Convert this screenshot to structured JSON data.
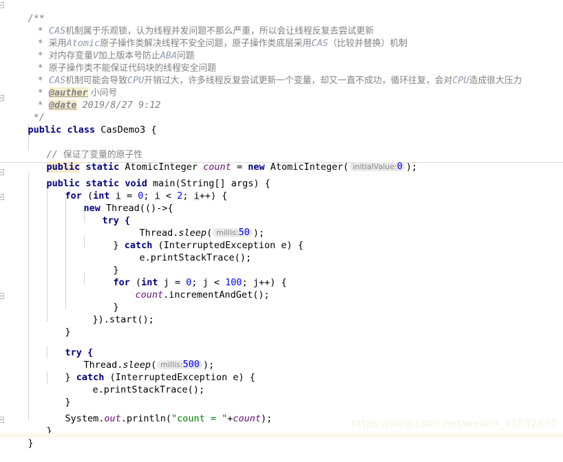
{
  "editor": {
    "language": "java",
    "class_name": "CasDemo3",
    "theme": {
      "background": "#ffffff",
      "foreground": "#000000",
      "keyword": "#000080",
      "number": "#0000ff",
      "string": "#008000",
      "static_field": "#660e7a",
      "comment": "#808080",
      "occurrence_highlight": "#f7eac8",
      "param_hint_bg": "#eaeaea",
      "param_hint_fg": "#888888",
      "indent_guide": "#d4d4d4",
      "method_separator": "#d8d8d8"
    },
    "javadoc": {
      "open": "/**",
      "close": " */",
      "lines": [
        {
          "prefix": " * ",
          "mono": "CAS",
          "text": "机制属于乐观锁，认为线程并发问题不那么严重，所以会让线程反复去尝试更新"
        },
        {
          "prefix": " * ",
          "text_before": "采用",
          "mono": "Atomic",
          "text": "原子操作类解决线程不安全问题，原子操作类底层采用",
          "mono2": "CAS",
          "text2": "（比较并替换）机制"
        },
        {
          "prefix": " * ",
          "text_before": "对内存变量",
          "mono": "V",
          "text": "加上版本号防止",
          "mono2": "ABA",
          "text2": "问题"
        },
        {
          "prefix": " * ",
          "text": "原子操作类不能保证代码块的线程安全问题"
        },
        {
          "prefix": " * ",
          "mono": "CAS",
          "text": "机制可能会导致",
          "mono2": "CPU",
          "text2": "开销过大，许多线程反复尝试更新一个变量，却又一直不成功，循环往复，会对",
          "mono3": "CPU",
          "text3": "造成很大压力"
        }
      ],
      "tags": [
        {
          "prefix": " * ",
          "tag": "@auther",
          "value": " 小问号"
        },
        {
          "prefix": " * ",
          "tag": "@date",
          "value": " 2019/8/27 9:12"
        }
      ]
    },
    "code": {
      "class_decl": {
        "modifier": "public",
        "keyword": "class",
        "name": "CasDemo3",
        "brace": " {"
      },
      "field_comment": {
        "slashes": "// ",
        "text": "保证了变量的原子性"
      },
      "field_decl": {
        "modifier": "public",
        "static": "static",
        "type": "AtomicInteger",
        "name": "count",
        "assign": " = ",
        "new_kw": "new",
        "ctor": "AtomicInteger(",
        "hint_label": "initialValue:",
        "hint_value": "0",
        "tail": ");"
      },
      "main_decl": {
        "modifier": "public",
        "static": "static",
        "ret": "void",
        "name": "main",
        "params": "(String[] args) {"
      },
      "outer_for": {
        "kw": "for",
        "open": " (",
        "type": "int",
        "var": "i",
        "init": " = ",
        "zero": "0",
        "semi1": "; ",
        "cond_var": "i",
        "lt": " < ",
        "limit": "2",
        "semi2": "; ",
        "inc_var": "i",
        "inc": "++) {"
      },
      "new_thread": {
        "kw": "new",
        "text": " Thread(()->{"
      },
      "try1": "try {",
      "sleep1": {
        "cls": "Thread.",
        "method": "sleep",
        "open": "(",
        "hint_label": "millis:",
        "hint_value": "50",
        "tail": ");"
      },
      "catch1": {
        "close": "} ",
        "kw": "catch",
        "rest": " (InterruptedException e) {"
      },
      "print_stack1": "e.printStackTrace();",
      "close_brace_a": "}",
      "inner_for": {
        "kw": "for",
        "open": " (",
        "type": "int",
        "var": "j",
        "init": " = ",
        "zero": "0",
        "semi1": "; ",
        "cond_var": "j",
        "lt": " < ",
        "limit": "100",
        "semi2": "; ",
        "inc_var": "j",
        "inc": "++) {"
      },
      "increment": {
        "field": "count",
        "call": ".incrementAndGet();"
      },
      "close_brace_b": "}",
      "thread_start": "}).start();",
      "close_brace_c": "}",
      "try2": "try {",
      "sleep2": {
        "cls": "Thread.",
        "method": "sleep",
        "open": "(",
        "hint_label": "millis:",
        "hint_value": "500",
        "tail": ");"
      },
      "catch2": {
        "close": "} ",
        "kw": "catch",
        "rest": " (InterruptedException e) {"
      },
      "print_stack2": "e.printStackTrace();",
      "close_brace_d": "}",
      "println": {
        "sys": "System.",
        "out": "out",
        "call": ".println(",
        "str": "\"count = \"",
        "plus": "+",
        "field": "count",
        "tail": ");"
      },
      "close_main": "}",
      "close_class": "}"
    }
  },
  "watermark": {
    "text": "https://blog.csdn.net/weixin_41832850"
  }
}
